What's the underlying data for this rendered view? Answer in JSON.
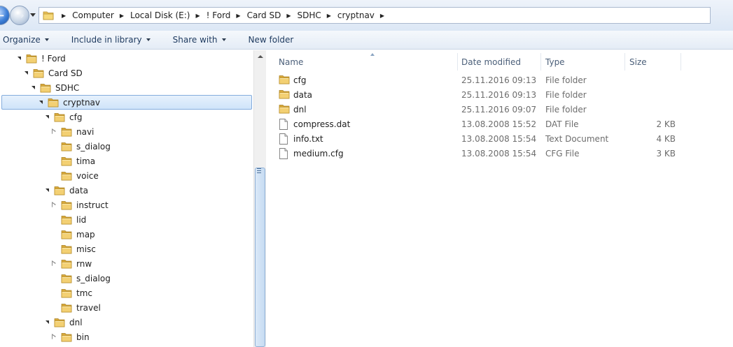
{
  "address": {
    "crumbs": [
      "Computer",
      "Local Disk (E:)",
      "! Ford",
      "Card SD",
      "SDHC",
      "cryptnav"
    ]
  },
  "toolbar": {
    "organize": "Organize",
    "include_in_library": "Include in library",
    "share_with": "Share with",
    "new_folder": "New folder"
  },
  "tree": [
    {
      "label": "! Ford",
      "depth": 0,
      "state": "open"
    },
    {
      "label": "Card SD",
      "depth": 1,
      "state": "open"
    },
    {
      "label": "SDHC",
      "depth": 2,
      "state": "open"
    },
    {
      "label": "cryptnav",
      "depth": 3,
      "state": "open",
      "selected": true
    },
    {
      "label": "cfg",
      "depth": 4,
      "state": "open"
    },
    {
      "label": "navi",
      "depth": 5,
      "state": "closed"
    },
    {
      "label": "s_dialog",
      "depth": 5,
      "state": "none"
    },
    {
      "label": "tima",
      "depth": 5,
      "state": "none"
    },
    {
      "label": "voice",
      "depth": 5,
      "state": "none"
    },
    {
      "label": "data",
      "depth": 4,
      "state": "open"
    },
    {
      "label": "instruct",
      "depth": 5,
      "state": "closed"
    },
    {
      "label": "lid",
      "depth": 5,
      "state": "none"
    },
    {
      "label": "map",
      "depth": 5,
      "state": "none"
    },
    {
      "label": "misc",
      "depth": 5,
      "state": "none"
    },
    {
      "label": "rnw",
      "depth": 5,
      "state": "closed"
    },
    {
      "label": "s_dialog",
      "depth": 5,
      "state": "none"
    },
    {
      "label": "tmc",
      "depth": 5,
      "state": "none"
    },
    {
      "label": "travel",
      "depth": 5,
      "state": "none"
    },
    {
      "label": "dnl",
      "depth": 4,
      "state": "open"
    },
    {
      "label": "bin",
      "depth": 5,
      "state": "closed"
    }
  ],
  "columns": {
    "name": "Name",
    "date_modified": "Date modified",
    "type": "Type",
    "size": "Size"
  },
  "files": [
    {
      "name": "cfg",
      "date": "25.11.2016 09:13",
      "type": "File folder",
      "size": "",
      "icon": "folder-icon"
    },
    {
      "name": "data",
      "date": "25.11.2016 09:13",
      "type": "File folder",
      "size": "",
      "icon": "folder-icon"
    },
    {
      "name": "dnl",
      "date": "25.11.2016 09:07",
      "type": "File folder",
      "size": "",
      "icon": "folder-icon"
    },
    {
      "name": "compress.dat",
      "date": "13.08.2008 15:52",
      "type": "DAT File",
      "size": "2 KB",
      "icon": "file-icon"
    },
    {
      "name": "info.txt",
      "date": "13.08.2008 15:54",
      "type": "Text Document",
      "size": "4 KB",
      "icon": "file-icon"
    },
    {
      "name": "medium.cfg",
      "date": "13.08.2008 15:54",
      "type": "CFG File",
      "size": "3 KB",
      "icon": "file-icon"
    }
  ]
}
